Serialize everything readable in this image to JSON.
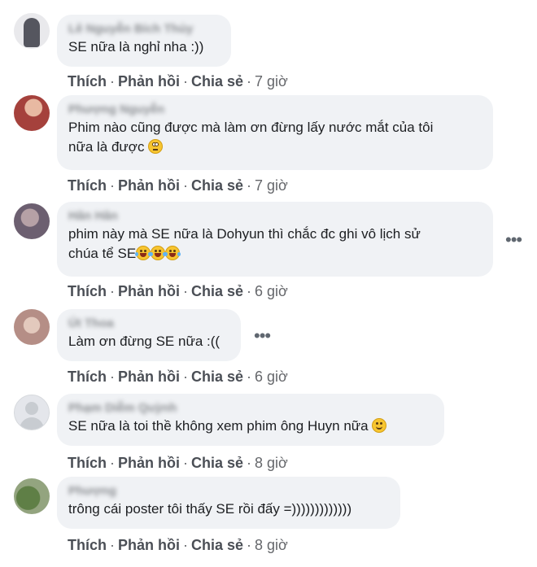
{
  "comments": [
    {
      "name": "Lê Nguyễn Bích Thủy",
      "text": "SE nữa là nghỉ nha :))",
      "text2": "",
      "emoji": [],
      "actions": {
        "like": "Thích",
        "reply": "Phản hồi",
        "share": "Chia sẻ",
        "time": "7 giờ"
      },
      "avatar_color": "#5a5a66"
    },
    {
      "name": "Phượng Nguyễn",
      "text": "Phim nào cũng được mà làm ơn đừng lấy nước mắt của tôi",
      "text2": "nữa là được",
      "emoji": [
        "face-with-rolling-eyes"
      ],
      "actions": {
        "like": "Thích",
        "reply": "Phản hồi",
        "share": "Chia sẻ",
        "time": "7 giờ"
      },
      "avatar_color": "#b24a48"
    },
    {
      "name": "Hân Hân",
      "text": "phim này mà SE nữa là Dohyun thì chắc đc ghi vô lịch sử",
      "text2": "chúa tể SE",
      "emoji": [
        "rolling-on-floor-laughing",
        "rolling-on-floor-laughing",
        "rolling-on-floor-laughing"
      ],
      "actions": {
        "like": "Thích",
        "reply": "Phản hồi",
        "share": "Chia sẻ",
        "time": "6 giờ"
      },
      "more": "•••",
      "avatar_color": "#7a6e7a"
    },
    {
      "name": "Út Thoa",
      "text": "Làm ơn đừng SE nữa :((",
      "text2": "",
      "emoji": [],
      "actions": {
        "like": "Thích",
        "reply": "Phản hồi",
        "share": "Chia sẻ",
        "time": "6 giờ"
      },
      "more": "•••",
      "avatar_color": "#c7a79c"
    },
    {
      "name": "Phạm Diễm Quỳnh",
      "text": "SE nữa là toi thề không xem phim ông Huyn nữa",
      "text2": "",
      "emoji": [
        "slightly-smiling-face"
      ],
      "actions": {
        "like": "Thích",
        "reply": "Phản hồi",
        "share": "Chia sẻ",
        "time": "8 giờ"
      },
      "avatar_color": "#e4e6eb"
    },
    {
      "name": "Phượng",
      "text": "trông cái poster tôi thấy SE rồi đấy =)))))))))))))",
      "text2": "",
      "emoji": [],
      "actions": {
        "like": "Thích",
        "reply": "Phản hồi",
        "share": "Chia sẻ",
        "time": "8 giờ"
      },
      "avatar_color": "#6f8a4e"
    }
  ]
}
